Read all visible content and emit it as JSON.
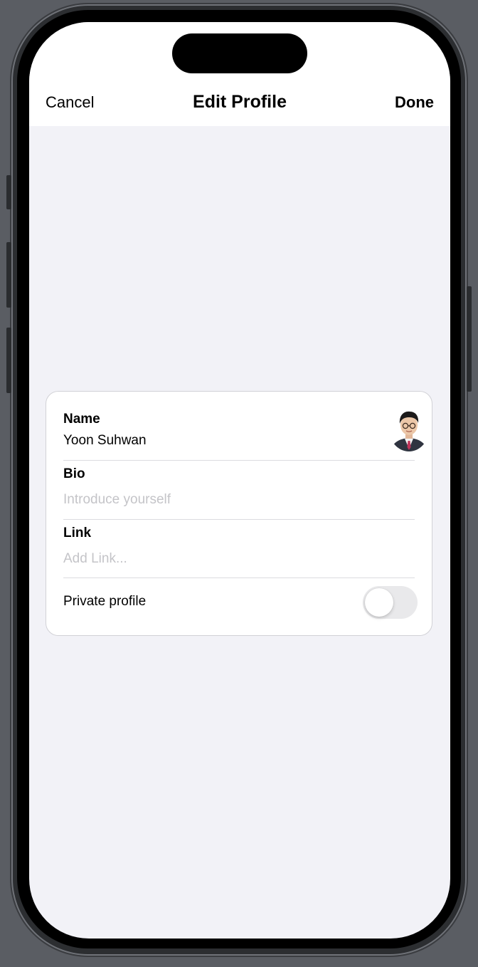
{
  "nav": {
    "cancel_label": "Cancel",
    "title": "Edit Profile",
    "done_label": "Done"
  },
  "profile": {
    "name_label": "Name",
    "name_value": "Yoon Suhwan",
    "bio_label": "Bio",
    "bio_placeholder": "Introduce yourself",
    "link_label": "Link",
    "link_placeholder": "Add Link...",
    "private_label": "Private profile",
    "private_enabled": false
  },
  "colors": {
    "background": "#f2f2f7",
    "card": "#ffffff",
    "placeholder": "#c4c4c8",
    "toggle_off": "#e9e9eb"
  }
}
